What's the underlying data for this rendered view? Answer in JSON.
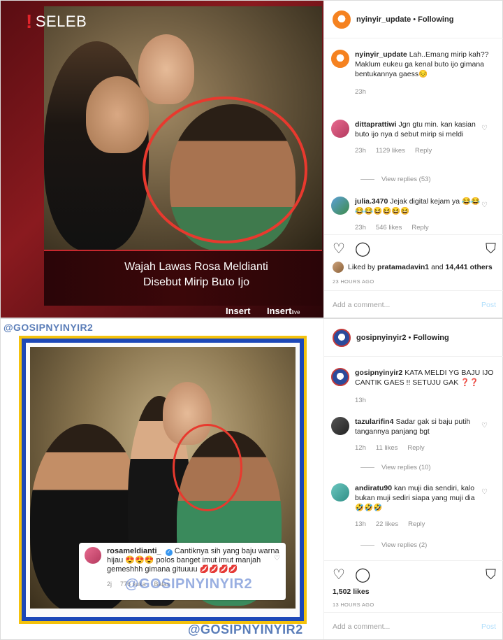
{
  "post1": {
    "media": {
      "badge": "SELEB",
      "title_line1": "Wajah Lawas Rosa Meldianti",
      "title_line2": "Disebut Mirip Buto Ijo",
      "brand1": "Insert",
      "brand2": "Insert",
      "brand2_small": "live"
    },
    "header": {
      "username": "nyinyir_update",
      "dot": "•",
      "follow": "Following"
    },
    "caption": {
      "username": "nyinyir_update",
      "text": "Lah..Emang mirip kah?? Maklum eukeu ga kenal buto ijo gimana bentukannya gaess😔",
      "time": "23h"
    },
    "comments": [
      {
        "username": "dittaprattiwi",
        "text": "Jgn gtu min. kan kasian buto ijo nya d sebut mirip si meldi",
        "time": "23h",
        "likes": "1129 likes",
        "reply": "Reply",
        "view_replies": "View replies (53)"
      },
      {
        "username": "julia.3470",
        "text": "Jejak digital kejam ya 😂😂😂😂😆😆😆😆",
        "time": "23h",
        "likes": "546 likes",
        "reply": "Reply"
      }
    ],
    "likes_prefix": "Liked by",
    "likes_user": "pratamadavin1",
    "likes_and": "and",
    "likes_count": "14,441 others",
    "timestamp": "23 HOURS AGO",
    "add_comment_placeholder": "Add a comment...",
    "post_button": "Post"
  },
  "post2": {
    "media": {
      "watermark_top": "@GOSIPNYINYIR2",
      "watermark_mid": "@GOSIPNYINYIR2",
      "watermark_bottom": "@GOSIPNYINYIR2",
      "ig_card": {
        "username": "rosameldianti_",
        "text": "Cantiknya sih yang baju warna hijau 😍😍😍 polos banget imut imut manjah gemeshhh gimana gituuuu 💋💋💋💋",
        "time": "2j",
        "likes": "776 suka",
        "reply": "Balas"
      }
    },
    "header": {
      "username": "gosipnyinyir2",
      "dot": "•",
      "follow": "Following"
    },
    "caption": {
      "username": "gosipnyinyir2",
      "text": "KATA MELDI YG BAJU IJO CANTIK GAES !! SETUJU GAK ❓❓",
      "time": "13h"
    },
    "comments": [
      {
        "username": "tazularifin4",
        "text": "Sadar gak si baju putih tangannya panjang bgt",
        "time": "12h",
        "likes": "11 likes",
        "reply": "Reply",
        "view_replies": "View replies (10)"
      },
      {
        "username": "andiratu90",
        "text": "kan muji dia sendiri, kalo bukan muji sediri siapa yang muji dia🤣🤣🤣",
        "time": "13h",
        "likes": "22 likes",
        "reply": "Reply",
        "view_replies": "View replies (2)"
      }
    ],
    "likes_count": "1,502 likes",
    "timestamp": "13 HOURS AGO",
    "add_comment_placeholder": "Add a comment...",
    "post_button": "Post"
  },
  "colors": {
    "brand_red": "#e3242b",
    "circle_red": "#e8392e",
    "frame_yellow": "#f4c20d",
    "frame_blue": "#1d48b8",
    "post_disabled": "#b2dffc"
  },
  "icons": [
    "heart-icon",
    "comment-icon",
    "bookmark-icon",
    "verified-icon"
  ]
}
